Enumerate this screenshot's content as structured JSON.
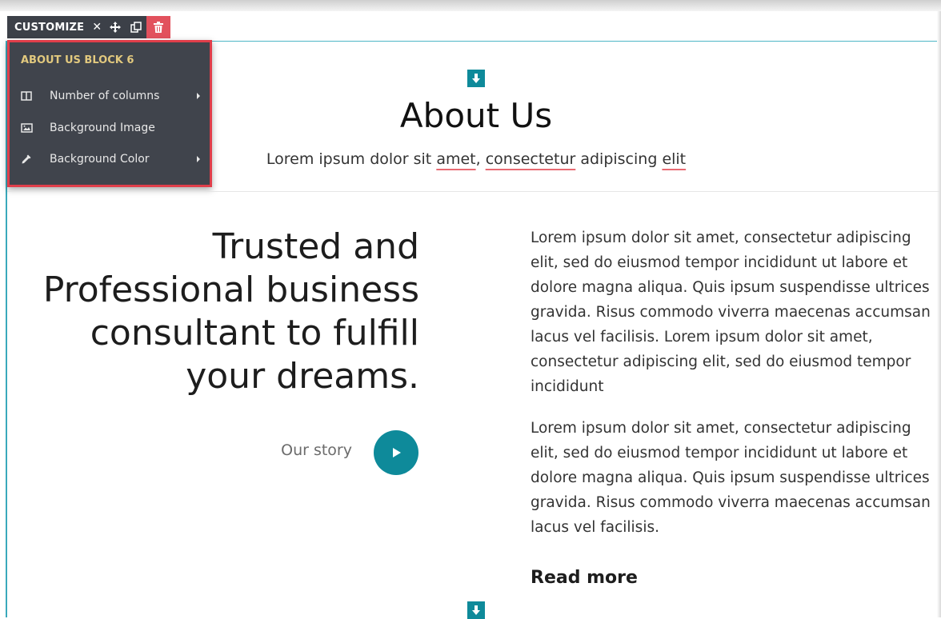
{
  "toolbar": {
    "title": "CUSTOMIZE"
  },
  "menu": {
    "title": "ABOUT US BLOCK 6",
    "items": [
      {
        "label": "Number of columns",
        "icon": "columns-icon",
        "submenu": true
      },
      {
        "label": "Background Image",
        "icon": "image-icon",
        "submenu": false
      },
      {
        "label": "Background Color",
        "icon": "eyedropper-icon",
        "submenu": true
      }
    ]
  },
  "section": {
    "title": "About Us",
    "subtitle": {
      "t1": "Lorem ipsum dolor sit ",
      "w1": "amet",
      "t2": ", ",
      "w2": "consectetur",
      "t3": " adipiscing ",
      "w3": "elit"
    }
  },
  "left": {
    "heading": "Trusted and Professional business consultant to fulfill your dreams.",
    "story_label": "Our story"
  },
  "right": {
    "para1": "Lorem ipsum dolor sit amet, consectetur adipiscing elit, sed do eiusmod tempor incididunt ut labore et dolore magna aliqua. Quis ipsum suspendisse ultrices gravida. Risus commodo viverra maecenas accumsan lacus vel facilisis. Lorem ipsum dolor sit amet, consectetur adipiscing elit, sed do eiusmod tempor incididunt",
    "para2": "Lorem ipsum dolor sit amet, consectetur adipiscing elit, sed do eiusmod tempor incididunt ut labore et dolore magna aliqua. Quis ipsum suspendisse ultrices gravida. Risus commodo viverra maecenas accumsan lacus vel facilisis.",
    "read_more": "Read more"
  },
  "colors": {
    "accent": "#0e8a9a",
    "toolbar_bg": "#3c4048",
    "danger": "#e2515d",
    "highlight_border": "#e03e4a",
    "menu_title": "#e2c97e"
  }
}
